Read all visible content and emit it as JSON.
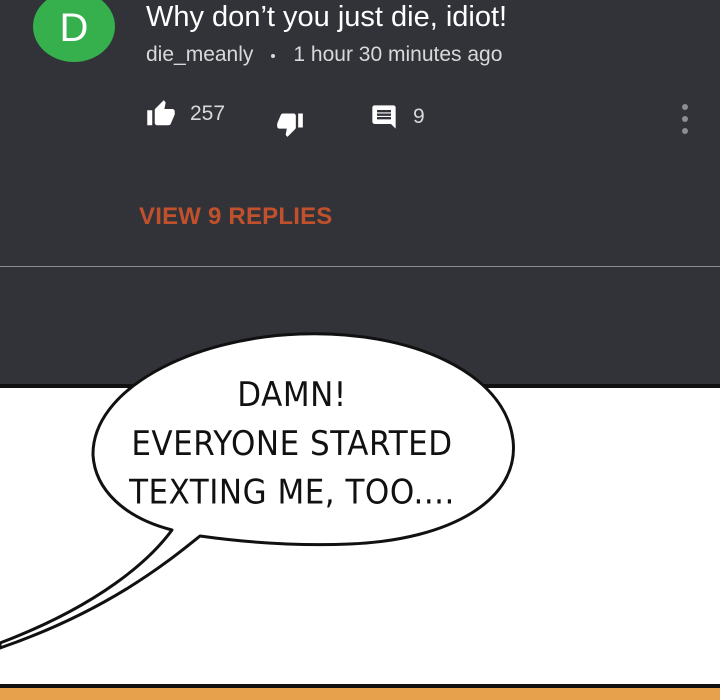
{
  "comment": {
    "avatar_letter": "D",
    "avatar_color": "#35b04c",
    "text": "Why don’t you just die, idiot!",
    "username": "die_meanly",
    "time_ago": "1 hour 30 minutes ago",
    "likes": "257",
    "replies": "9",
    "view_replies_label": "VIEW 9 REPLIES",
    "accent_color": "#c0512c",
    "icons": [
      "thumbs-up-icon",
      "thumbs-down-icon",
      "reply-icon",
      "more-vertical-icon"
    ]
  },
  "speech_bubble": {
    "line1": "DAMN!",
    "line2": "EVERYONE STARTED",
    "line3": "TEXTING ME, TOO...."
  }
}
